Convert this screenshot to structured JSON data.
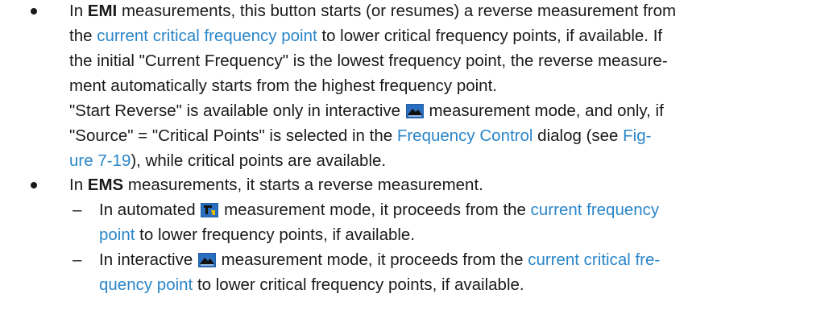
{
  "colors": {
    "link": "#2b86c9",
    "text": "#1a1a1a"
  },
  "icons": {
    "interactive_mode": "interactive-mode-icon",
    "automated_mode": "automated-mode-icon"
  },
  "b1": {
    "l1a": "In ",
    "l1b": "EMI",
    "l1c": " measurements, this button starts (or resumes) a reverse measurement from",
    "l2a": "the ",
    "l2link": "current critical frequency point",
    "l2b": " to lower critical frequency points, if available. If",
    "l3": "the initial \"Current Frequency\" is the lowest frequency point, the reverse measure-",
    "l4": "ment automatically starts from the highest frequency point.",
    "l5": "\"Start Reverse\" is available only in interactive ",
    "l5b": " measurement mode, and only, if",
    "l6a": "\"Source\" = \"Critical Points\" is selected in the ",
    "l6link1": "Frequency Control",
    "l6b": " dialog (see ",
    "l6link2": "Fig-",
    "l7link": "ure 7-19",
    "l7b": "), while critical points are available."
  },
  "b2": {
    "l1a": "In ",
    "l1b": "EMS",
    "l1c": " measurements, it starts a reverse measurement.",
    "d1": {
      "dash": "–",
      "l1a": "In automated ",
      "l1b": " measurement mode, it proceeds from the ",
      "l1link": "current frequency",
      "l2link": "point",
      "l2b": " to lower frequency points, if available."
    },
    "d2": {
      "dash": "–",
      "l1a": "In interactive ",
      "l1b": " measurement mode, it proceeds from the ",
      "l1link": "current critical fre-",
      "l2link": "quency point",
      "l2b": " to lower critical frequency points, if available."
    }
  }
}
